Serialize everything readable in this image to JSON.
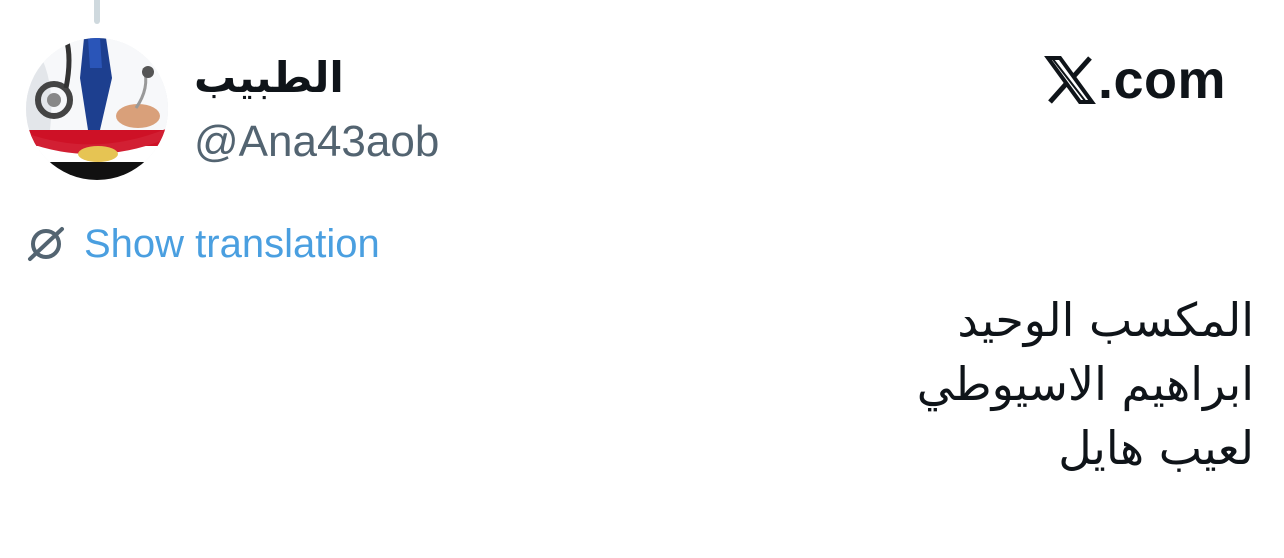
{
  "header": {
    "display_name": "الطبيب",
    "handle": "@Ana43aob",
    "brand": "𝕏.com",
    "brand_domain": ".com"
  },
  "translation": {
    "label": "Show translation",
    "icon": "translate-globe-icon"
  },
  "tweet": {
    "lines": [
      "المكسب الوحيد",
      "ابراهيم الاسيوطي",
      "لعيب هايل"
    ]
  },
  "colors": {
    "text_primary": "#0f1419",
    "text_secondary": "#536471",
    "link_blue": "#4a9fe0",
    "thread_line": "#cfd9de",
    "flag_red": "#ce1126",
    "flag_black": "#000000",
    "flag_gold": "#c09300"
  }
}
